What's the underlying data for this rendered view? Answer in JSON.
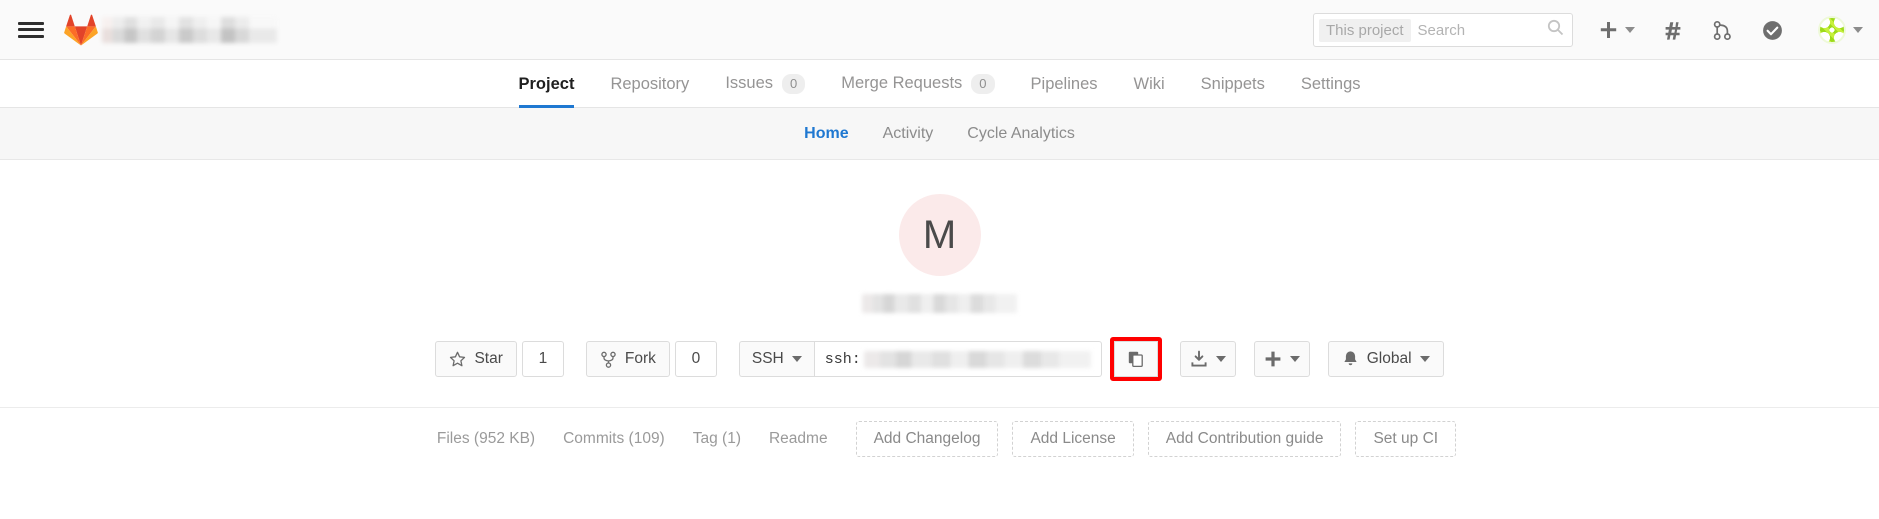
{
  "navbar": {
    "menu_icon": "hamburger-menu-icon",
    "logo_icon": "gitlab-fox-logo",
    "brand_name_redacted": true,
    "search": {
      "scope_label": "This project",
      "placeholder": "Search",
      "icon": "search-icon"
    },
    "icons": [
      {
        "name": "plus-icon",
        "glyph": "+",
        "has_caret": true
      },
      {
        "name": "hash-issues-icon",
        "glyph": "#",
        "has_caret": false
      },
      {
        "name": "merge-request-icon",
        "glyph": "merge",
        "has_caret": false
      },
      {
        "name": "todos-check-icon",
        "glyph": "check",
        "has_caret": false
      },
      {
        "name": "user-avatar-identicon",
        "glyph": "identicon",
        "has_caret": true
      }
    ]
  },
  "tabs": [
    {
      "label": "Project",
      "badge": null,
      "active": true
    },
    {
      "label": "Repository",
      "badge": null,
      "active": false
    },
    {
      "label": "Issues",
      "badge": "0",
      "active": false
    },
    {
      "label": "Merge Requests",
      "badge": "0",
      "active": false
    },
    {
      "label": "Pipelines",
      "badge": null,
      "active": false
    },
    {
      "label": "Wiki",
      "badge": null,
      "active": false
    },
    {
      "label": "Snippets",
      "badge": null,
      "active": false
    },
    {
      "label": "Settings",
      "badge": null,
      "active": false
    }
  ],
  "subnav": [
    {
      "label": "Home",
      "active": true
    },
    {
      "label": "Activity",
      "active": false
    },
    {
      "label": "Cycle Analytics",
      "active": false
    }
  ],
  "project": {
    "avatar_letter": "M",
    "avatar_bg": "#fbeaea",
    "title_redacted": true
  },
  "actions": {
    "star": {
      "label": "Star",
      "icon": "star-icon",
      "count": "1"
    },
    "fork": {
      "label": "Fork",
      "icon": "fork-icon",
      "count": "0"
    },
    "clone": {
      "protocol_label": "SSH",
      "url_prefix": "ssh:",
      "url_redacted": true,
      "copy_button_icon": "copy-clipboard-icon",
      "copy_highlight_color": "#ff0000"
    },
    "download": {
      "icon": "download-icon",
      "has_caret": true
    },
    "add_new": {
      "icon": "plus-icon",
      "has_caret": true
    },
    "notifications": {
      "icon": "bell-icon",
      "label": "Global",
      "has_caret": true
    }
  },
  "stats": [
    {
      "label": "Files (952 KB)"
    },
    {
      "label": "Commits (109)"
    },
    {
      "label": "Tag (1)"
    },
    {
      "label": "Readme"
    }
  ],
  "quick_actions": [
    {
      "label": "Add Changelog"
    },
    {
      "label": "Add License"
    },
    {
      "label": "Add Contribution guide"
    },
    {
      "label": "Set up CI"
    }
  ]
}
